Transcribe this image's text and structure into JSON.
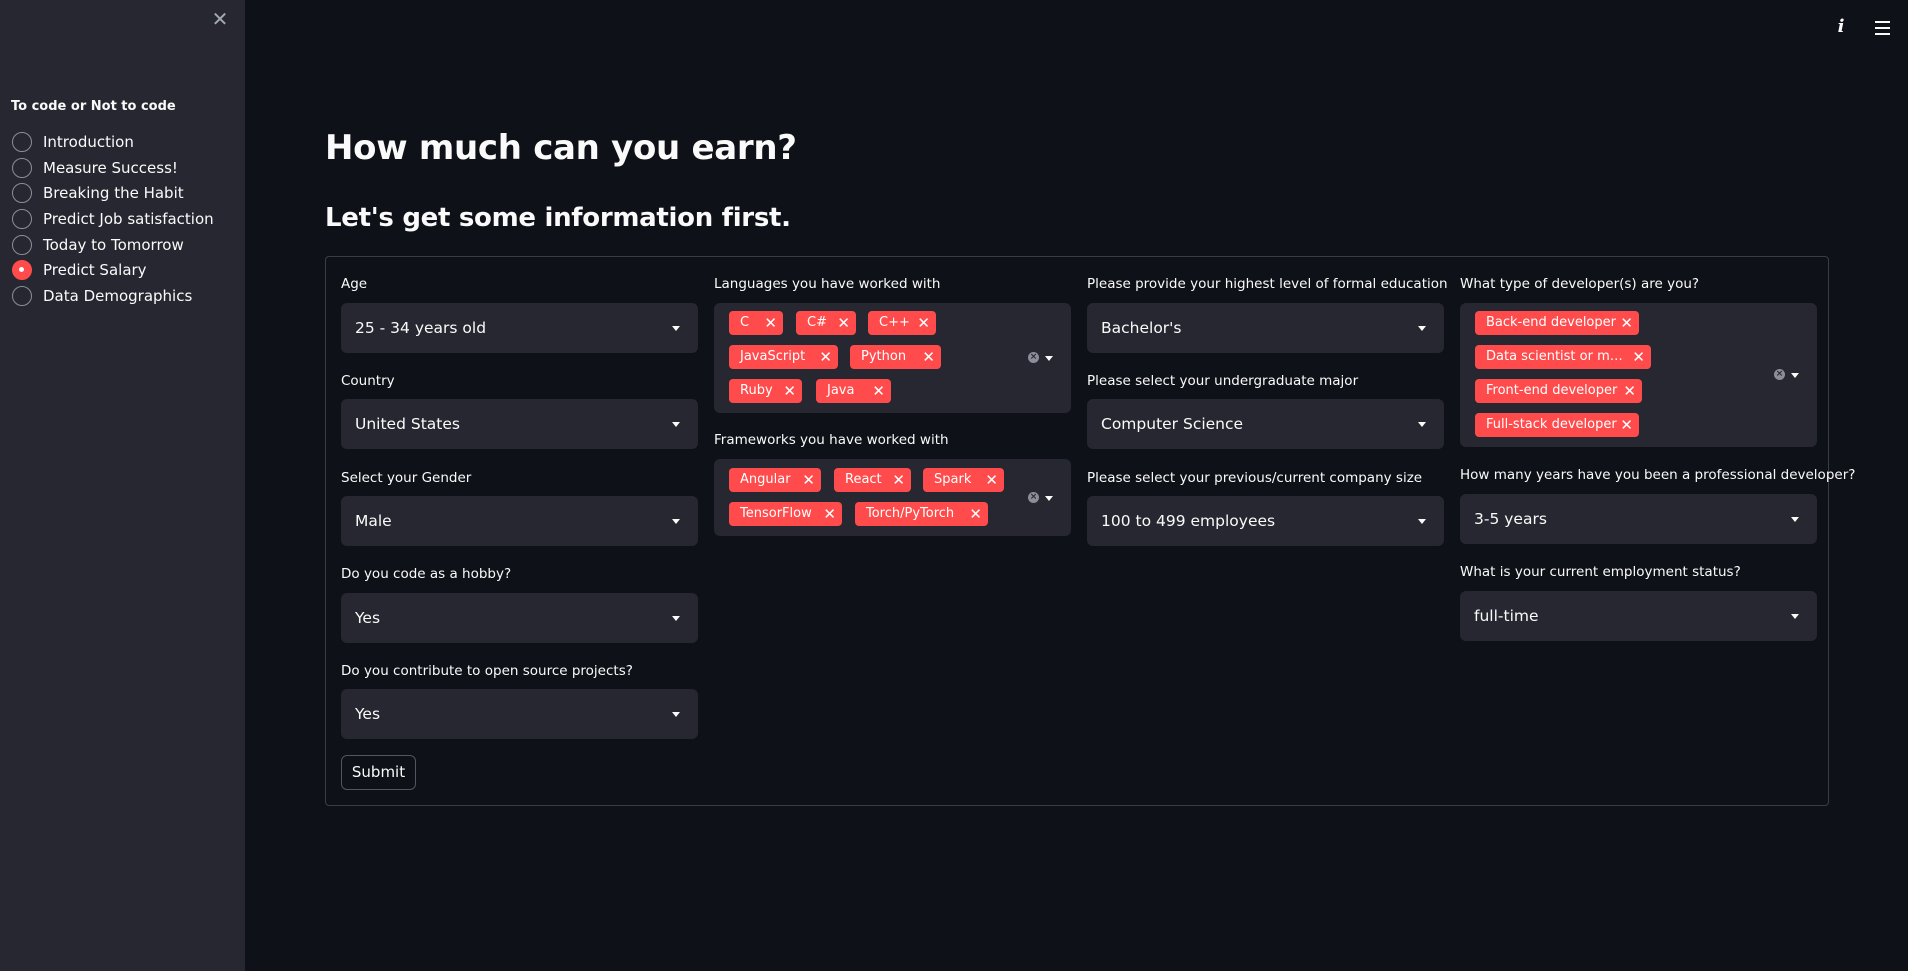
{
  "sidebar": {
    "title": "To code or Not to code",
    "items": [
      {
        "label": "Introduction",
        "selected": false
      },
      {
        "label": "Measure Success!",
        "selected": false
      },
      {
        "label": "Breaking the Habit",
        "selected": false
      },
      {
        "label": "Predict Job satisfaction",
        "selected": false
      },
      {
        "label": "Today to Tomorrow",
        "selected": false
      },
      {
        "label": "Predict Salary",
        "selected": true
      },
      {
        "label": "Data Demographics",
        "selected": false
      }
    ]
  },
  "header": {
    "title": "How much can you earn?",
    "subtitle": "Let's get some information first."
  },
  "form": {
    "age": {
      "label": "Age",
      "value": "25 - 34 years old"
    },
    "country": {
      "label": "Country",
      "value": "United States"
    },
    "gender": {
      "label": "Select your Gender",
      "value": "Male"
    },
    "hobby": {
      "label": "Do you code as a hobby?",
      "value": "Yes"
    },
    "open_source": {
      "label": "Do you contribute to open source projects?",
      "value": "Yes"
    },
    "languages": {
      "label": "Languages you have worked with",
      "tags": [
        "C",
        "C#",
        "C++",
        "JavaScript",
        "Python",
        "Ruby",
        "Java"
      ]
    },
    "frameworks": {
      "label": "Frameworks you have worked with",
      "tags": [
        "Angular",
        "React",
        "Spark",
        "TensorFlow",
        "Torch/PyTorch"
      ]
    },
    "education": {
      "label": "Please provide your highest level of formal education",
      "value": "Bachelor's"
    },
    "major": {
      "label": "Please select your undergraduate major",
      "value": "Computer Science"
    },
    "company_size": {
      "label": "Please select your previous/current company size",
      "value": "100 to 499 employees"
    },
    "dev_type": {
      "label": "What type of developer(s) are you?",
      "tags": [
        "Back-end developer",
        "Data scientist or m…",
        "Front-end developer",
        "Full-stack developer"
      ]
    },
    "years_pro": {
      "label": "How many years have you been a professional developer?",
      "value": "3-5 years"
    },
    "employment": {
      "label": "What is your current employment status?",
      "value": "full-time"
    },
    "submit_label": "Submit"
  },
  "icons": {
    "close": "close-icon",
    "info": "info-icon",
    "menu": "hamburger-menu-icon",
    "tag_remove": "remove-tag-icon",
    "clear": "clear-all-icon",
    "dropdown": "chevron-down-icon"
  },
  "colors": {
    "accent": "#ff4b4b",
    "background": "#0e1117",
    "sidebar": "#262730",
    "input": "#262730"
  }
}
